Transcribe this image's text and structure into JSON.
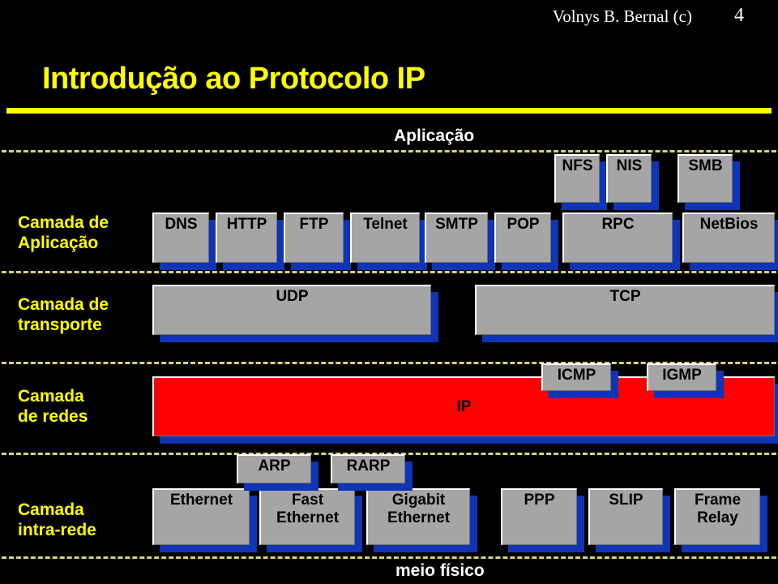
{
  "header": {
    "author": "Volnys B. Bernal (c)",
    "page_number": "4"
  },
  "title": "Introdução ao Protocolo IP",
  "colors": {
    "title": "#ffff00",
    "rule": "#ffff00",
    "box_fill": "#a5a5a5",
    "box_shadow": "#0f34b5",
    "ip_fill": "#ff0000",
    "background": "#000000",
    "dashed_line": "#d8d27a",
    "layer_label": "#ffff00",
    "center_label": "#ffffff"
  },
  "diagram": {
    "top_label": "Aplicação",
    "bottom_label": "meio físico",
    "layers": [
      {
        "name": "layer-application",
        "label": "Camada de\nAplicação"
      },
      {
        "name": "layer-transport",
        "label": "Camada de\ntransporte"
      },
      {
        "name": "layer-network",
        "label": "Camada\nde redes"
      },
      {
        "name": "layer-intranet",
        "label": "Camada\nintra-rede"
      }
    ],
    "protocols": {
      "upper_application": [
        {
          "name": "nfs",
          "label": "NFS"
        },
        {
          "name": "nis",
          "label": "NIS"
        },
        {
          "name": "smb",
          "label": "SMB"
        }
      ],
      "application": [
        {
          "name": "dns",
          "label": "DNS"
        },
        {
          "name": "http",
          "label": "HTTP"
        },
        {
          "name": "ftp",
          "label": "FTP"
        },
        {
          "name": "telnet",
          "label": "Telnet"
        },
        {
          "name": "smtp",
          "label": "SMTP"
        },
        {
          "name": "pop",
          "label": "POP"
        },
        {
          "name": "rpc",
          "label": "RPC"
        },
        {
          "name": "netbios",
          "label": "NetBios"
        }
      ],
      "transport": [
        {
          "name": "udp",
          "label": "UDP"
        },
        {
          "name": "tcp",
          "label": "TCP"
        }
      ],
      "network": [
        {
          "name": "ip",
          "label": "IP"
        },
        {
          "name": "icmp",
          "label": "ICMP"
        },
        {
          "name": "igmp",
          "label": "IGMP"
        }
      ],
      "address_resolution": [
        {
          "name": "arp",
          "label": "ARP"
        },
        {
          "name": "rarp",
          "label": "RARP"
        }
      ],
      "intranet": [
        {
          "name": "ethernet",
          "label": "Ethernet"
        },
        {
          "name": "fast-ethernet",
          "label": "Fast\nEthernet"
        },
        {
          "name": "gigabit-ethernet",
          "label": "Gigabit\nEthernet"
        },
        {
          "name": "ppp",
          "label": "PPP"
        },
        {
          "name": "slip",
          "label": "SLIP"
        },
        {
          "name": "frame-relay",
          "label": "Frame\nRelay"
        }
      ]
    }
  }
}
